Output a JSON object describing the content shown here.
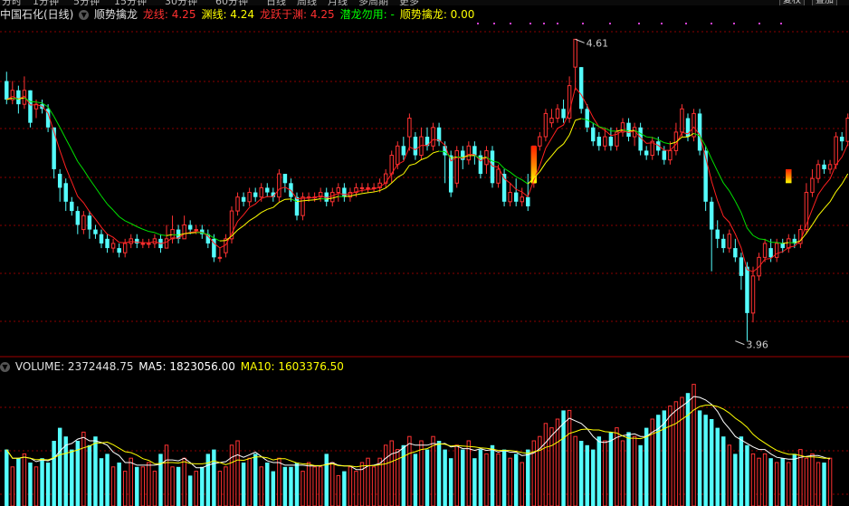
{
  "tabs": [
    "分时",
    "1分钟",
    "5分钟",
    "15分钟",
    "30分钟",
    "60分钟",
    "日线",
    "周线",
    "月线",
    "多周期",
    "更多"
  ],
  "toolbar": {
    "left_btn": "复权",
    "right_btn": "叠加"
  },
  "price_header": {
    "stock": "中国石化(日线)",
    "indicator": "顺势擒龙",
    "items": [
      {
        "label": "龙线: 4.25",
        "color": "#ff3030"
      },
      {
        "label": "渊线: 4.24",
        "color": "#ffff00"
      },
      {
        "label": "龙跃于渊: 4.25",
        "color": "#ff3030"
      },
      {
        "label": "潜龙勿用: -",
        "color": "#00ff00"
      },
      {
        "label": "顺势擒龙: 0.00",
        "color": "#ffff00"
      }
    ]
  },
  "volume_header": {
    "name": "VOLUME: 2372448.75",
    "ma5": "MA5: 1823056.00",
    "ma10": "MA10: 1603376.50"
  },
  "colors": {
    "up": "#ff3232",
    "down": "#54fcfc",
    "ma_short": "#ff2020",
    "ma_long": "#ffff00",
    "volma5": "#ffffff",
    "volma10": "#ffff00",
    "grid": "#8b0000",
    "axis": "#a00000"
  },
  "chart_data": {
    "type": "candlestick",
    "price_range": [
      3.93,
      4.64
    ],
    "annotations": [
      {
        "label": "4.61",
        "value": 4.61,
        "index": 96
      },
      {
        "label": "3.96",
        "value": 3.96,
        "index": 123
      }
    ],
    "signals": [
      {
        "index": 89,
        "low": 4.3,
        "high": 4.38,
        "kind": "gradient"
      },
      {
        "index": 132,
        "low": 4.3,
        "high": 4.33,
        "kind": "gradient"
      }
    ],
    "candles": [
      [
        4.52,
        4.48,
        4.54,
        4.47
      ],
      [
        4.48,
        4.5,
        4.52,
        4.47
      ],
      [
        4.5,
        4.47,
        4.51,
        4.45
      ],
      [
        4.47,
        4.5,
        4.53,
        4.46
      ],
      [
        4.5,
        4.43,
        4.5,
        4.42
      ],
      [
        4.46,
        4.47,
        4.48,
        4.44
      ],
      [
        4.47,
        4.46,
        4.48,
        4.45
      ],
      [
        4.46,
        4.42,
        4.47,
        4.41
      ],
      [
        4.42,
        4.33,
        4.42,
        4.31
      ],
      [
        4.32,
        4.29,
        4.33,
        4.26
      ],
      [
        4.3,
        4.26,
        4.31,
        4.24
      ],
      [
        4.26,
        4.24,
        4.27,
        4.23
      ],
      [
        4.24,
        4.21,
        4.25,
        4.19
      ],
      [
        4.2,
        4.23,
        4.24,
        4.19
      ],
      [
        4.23,
        4.2,
        4.24,
        4.18
      ],
      [
        4.2,
        4.19,
        4.21,
        4.18
      ],
      [
        4.19,
        4.17,
        4.2,
        4.16
      ],
      [
        4.18,
        4.16,
        4.19,
        4.15
      ],
      [
        4.16,
        4.17,
        4.18,
        4.15
      ],
      [
        4.16,
        4.15,
        4.17,
        4.14
      ],
      [
        4.15,
        4.17,
        4.18,
        4.14
      ],
      [
        4.17,
        4.18,
        4.19,
        4.16
      ],
      [
        4.18,
        4.17,
        4.19,
        4.16
      ],
      [
        4.17,
        4.17,
        4.18,
        4.16
      ],
      [
        4.17,
        4.17,
        4.18,
        4.16
      ],
      [
        4.17,
        4.18,
        4.19,
        4.16
      ],
      [
        4.18,
        4.16,
        4.19,
        4.15
      ],
      [
        4.16,
        4.18,
        4.21,
        4.16
      ],
      [
        4.18,
        4.2,
        4.23,
        4.17
      ],
      [
        4.2,
        4.18,
        4.21,
        4.17
      ],
      [
        4.18,
        4.21,
        4.23,
        4.18
      ],
      [
        4.21,
        4.2,
        4.22,
        4.19
      ],
      [
        4.2,
        4.2,
        4.21,
        4.19
      ],
      [
        4.2,
        4.19,
        4.21,
        4.18
      ],
      [
        4.19,
        4.17,
        4.2,
        4.16
      ],
      [
        4.18,
        4.14,
        4.19,
        4.13
      ],
      [
        4.14,
        4.14,
        4.16,
        4.13
      ],
      [
        4.15,
        4.18,
        4.19,
        4.14
      ],
      [
        4.18,
        4.24,
        4.25,
        4.17
      ],
      [
        4.24,
        4.27,
        4.28,
        4.23
      ],
      [
        4.27,
        4.26,
        4.28,
        4.25
      ],
      [
        4.26,
        4.28,
        4.29,
        4.25
      ],
      [
        4.28,
        4.27,
        4.29,
        4.26
      ],
      [
        4.27,
        4.29,
        4.3,
        4.26
      ],
      [
        4.29,
        4.28,
        4.3,
        4.27
      ],
      [
        4.28,
        4.27,
        4.29,
        4.26
      ],
      [
        4.27,
        4.32,
        4.33,
        4.26
      ],
      [
        4.32,
        4.3,
        4.32,
        4.28
      ],
      [
        4.3,
        4.27,
        4.31,
        4.26
      ],
      [
        4.27,
        4.23,
        4.28,
        4.22
      ],
      [
        4.23,
        4.27,
        4.28,
        4.22
      ],
      [
        4.27,
        4.27,
        4.28,
        4.26
      ],
      [
        4.27,
        4.27,
        4.28,
        4.26
      ],
      [
        4.27,
        4.28,
        4.29,
        4.26
      ],
      [
        4.28,
        4.26,
        4.29,
        4.25
      ],
      [
        4.26,
        4.28,
        4.29,
        4.25
      ],
      [
        4.28,
        4.29,
        4.3,
        4.26
      ],
      [
        4.29,
        4.27,
        4.3,
        4.26
      ],
      [
        4.27,
        4.28,
        4.29,
        4.26
      ],
      [
        4.28,
        4.29,
        4.3,
        4.27
      ],
      [
        4.29,
        4.29,
        4.3,
        4.28
      ],
      [
        4.29,
        4.29,
        4.3,
        4.28
      ],
      [
        4.29,
        4.29,
        4.3,
        4.28
      ],
      [
        4.29,
        4.3,
        4.31,
        4.28
      ],
      [
        4.3,
        4.32,
        4.33,
        4.29
      ],
      [
        4.32,
        4.36,
        4.37,
        4.3
      ],
      [
        4.34,
        4.38,
        4.39,
        4.33
      ],
      [
        4.38,
        4.36,
        4.4,
        4.35
      ],
      [
        4.4,
        4.44,
        4.45,
        4.37
      ],
      [
        4.4,
        4.36,
        4.41,
        4.35
      ],
      [
        4.36,
        4.4,
        4.42,
        4.35
      ],
      [
        4.4,
        4.38,
        4.42,
        4.37
      ],
      [
        4.38,
        4.42,
        4.43,
        4.37
      ],
      [
        4.42,
        4.39,
        4.43,
        4.38
      ],
      [
        4.38,
        4.36,
        4.39,
        4.3
      ],
      [
        4.36,
        4.28,
        4.37,
        4.27
      ],
      [
        4.3,
        4.37,
        4.38,
        4.29
      ],
      [
        4.37,
        4.35,
        4.38,
        4.33
      ],
      [
        4.35,
        4.38,
        4.39,
        4.34
      ],
      [
        4.38,
        4.36,
        4.39,
        4.34
      ],
      [
        4.36,
        4.32,
        4.37,
        4.31
      ],
      [
        4.34,
        4.37,
        4.38,
        4.32
      ],
      [
        4.37,
        4.3,
        4.38,
        4.29
      ],
      [
        4.3,
        4.33,
        4.34,
        4.29
      ],
      [
        4.32,
        4.26,
        4.33,
        4.25
      ],
      [
        4.26,
        4.28,
        4.3,
        4.25
      ],
      [
        4.28,
        4.26,
        4.31,
        4.25
      ],
      [
        4.26,
        4.27,
        4.29,
        4.25
      ],
      [
        4.27,
        4.25,
        4.32,
        4.24
      ],
      [
        4.3,
        4.38,
        4.38,
        4.29
      ],
      [
        4.38,
        4.4,
        4.41,
        4.37
      ],
      [
        4.4,
        4.45,
        4.46,
        4.39
      ],
      [
        4.43,
        4.44,
        4.46,
        4.42
      ],
      [
        4.44,
        4.46,
        4.47,
        4.43
      ],
      [
        4.46,
        4.44,
        4.48,
        4.43
      ],
      [
        4.44,
        4.51,
        4.53,
        4.43
      ],
      [
        4.55,
        4.61,
        4.61,
        4.5
      ],
      [
        4.55,
        4.46,
        4.55,
        4.45
      ],
      [
        4.46,
        4.42,
        4.47,
        4.41
      ],
      [
        4.42,
        4.39,
        4.43,
        4.38
      ],
      [
        4.4,
        4.38,
        4.41,
        4.37
      ],
      [
        4.38,
        4.4,
        4.42,
        4.37
      ],
      [
        4.4,
        4.38,
        4.42,
        4.37
      ],
      [
        4.38,
        4.41,
        4.42,
        4.37
      ],
      [
        4.41,
        4.43,
        4.44,
        4.4
      ],
      [
        4.43,
        4.4,
        4.44,
        4.39
      ],
      [
        4.4,
        4.42,
        4.43,
        4.38
      ],
      [
        4.42,
        4.37,
        4.43,
        4.36
      ],
      [
        4.37,
        4.36,
        4.38,
        4.35
      ],
      [
        4.36,
        4.39,
        4.4,
        4.35
      ],
      [
        4.39,
        4.37,
        4.4,
        4.36
      ],
      [
        4.37,
        4.35,
        4.38,
        4.34
      ],
      [
        4.35,
        4.37,
        4.39,
        4.34
      ],
      [
        4.37,
        4.41,
        4.43,
        4.36
      ],
      [
        4.41,
        4.46,
        4.47,
        4.4
      ],
      [
        4.44,
        4.4,
        4.45,
        4.39
      ],
      [
        4.4,
        4.45,
        4.46,
        4.39
      ],
      [
        4.45,
        4.37,
        4.46,
        4.36
      ],
      [
        4.37,
        4.26,
        4.38,
        4.24
      ],
      [
        4.26,
        4.2,
        4.27,
        4.11
      ],
      [
        4.2,
        4.18,
        4.22,
        4.16
      ],
      [
        4.18,
        4.16,
        4.19,
        4.15
      ],
      [
        4.16,
        4.19,
        4.2,
        4.15
      ],
      [
        4.16,
        4.14,
        4.18,
        4.13
      ],
      [
        4.14,
        4.1,
        4.15,
        4.07
      ],
      [
        4.12,
        4.02,
        4.13,
        3.96
      ],
      [
        4.02,
        4.1,
        4.12,
        4.0
      ],
      [
        4.1,
        4.14,
        4.15,
        4.09
      ],
      [
        4.14,
        4.17,
        4.18,
        4.13
      ],
      [
        4.16,
        4.14,
        4.18,
        4.13
      ],
      [
        4.14,
        4.17,
        4.18,
        4.13
      ],
      [
        4.17,
        4.16,
        4.18,
        4.15
      ],
      [
        4.16,
        4.18,
        4.19,
        4.15
      ],
      [
        4.18,
        4.17,
        4.19,
        4.16
      ],
      [
        4.17,
        4.2,
        4.21,
        4.16
      ],
      [
        4.2,
        4.28,
        4.3,
        4.19
      ],
      [
        4.28,
        4.31,
        4.33,
        4.27
      ],
      [
        4.31,
        4.34,
        4.35,
        4.3
      ],
      [
        4.34,
        4.33,
        4.35,
        4.32
      ],
      [
        4.33,
        4.34,
        4.35,
        4.32
      ],
      [
        4.34,
        4.4,
        4.41,
        4.33
      ],
      [
        4.4,
        4.39,
        4.41,
        4.37
      ],
      [
        4.39,
        4.44,
        4.45,
        4.38
      ]
    ],
    "volumes": [
      13,
      9,
      11,
      12,
      10,
      9,
      11,
      10,
      15,
      18,
      16,
      13,
      15,
      17,
      14,
      16,
      11,
      12,
      9,
      10,
      8,
      11,
      9,
      9,
      10,
      8,
      12,
      14,
      9,
      9,
      11,
      7,
      8,
      9,
      12,
      13,
      8,
      9,
      14,
      15,
      10,
      11,
      12,
      9,
      10,
      8,
      11,
      9,
      9,
      10,
      8,
      10,
      9,
      9,
      12,
      10,
      7,
      8,
      9,
      8,
      10,
      11,
      9,
      11,
      14,
      15,
      13,
      14,
      16,
      12,
      15,
      13,
      16,
      15,
      13,
      11,
      14,
      13,
      15,
      11,
      13,
      12,
      14,
      12,
      13,
      11,
      12,
      10,
      13,
      15,
      16,
      19,
      18,
      20,
      22,
      22,
      16,
      15,
      14,
      13,
      16,
      15,
      17,
      18,
      15,
      17,
      16,
      14,
      18,
      20,
      21,
      22,
      23,
      24,
      25,
      26,
      28,
      22,
      21,
      20,
      18,
      16,
      14,
      12,
      16,
      14,
      12,
      11,
      12,
      11,
      10,
      11,
      10,
      12,
      13,
      11,
      12,
      10,
      10,
      11
    ]
  }
}
